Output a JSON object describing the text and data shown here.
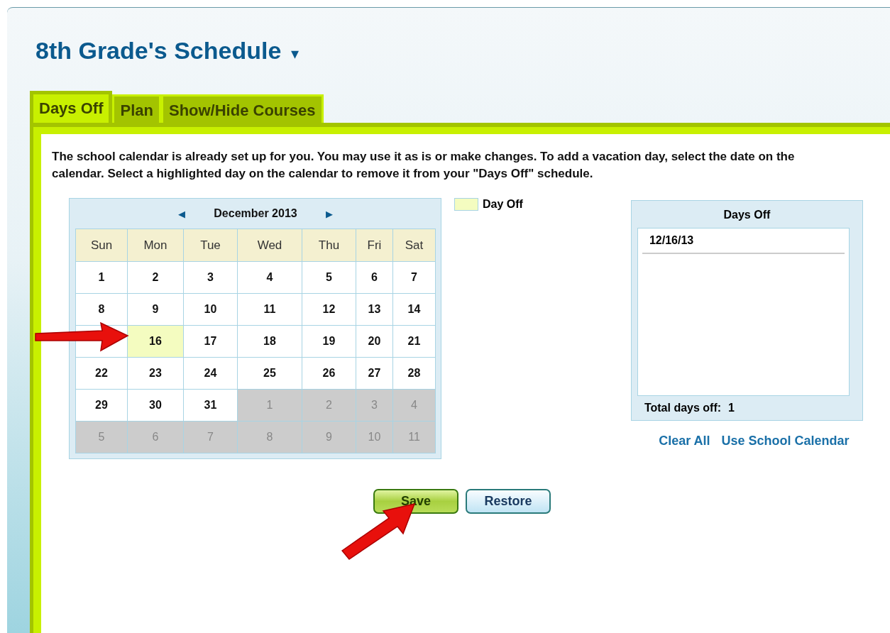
{
  "title": "8th Grade's Schedule",
  "title_menu_caret": "▾",
  "tabs": [
    {
      "label": "Days Off",
      "selected": true
    },
    {
      "label": "Plan",
      "selected": false
    },
    {
      "label": "Show/Hide Courses",
      "selected": false
    }
  ],
  "instructions": "The school calendar is already set up for you. You may use it as is or make changes. To add a vacation day, select the date on the calendar. Select a highlighted day on the calendar to remove it from your \"Days Off\" schedule.",
  "calendar": {
    "prev": "◀",
    "month": "December 2013",
    "next": "▶",
    "weekdays": [
      "Sun",
      "Mon",
      "Tue",
      "Wed",
      "Thu",
      "Fri",
      "Sat"
    ],
    "weeks": [
      [
        {
          "day": "1",
          "kind": "current",
          "selected": false
        },
        {
          "day": "2",
          "kind": "current",
          "selected": false
        },
        {
          "day": "3",
          "kind": "current",
          "selected": false
        },
        {
          "day": "4",
          "kind": "current",
          "selected": false
        },
        {
          "day": "5",
          "kind": "current",
          "selected": false
        },
        {
          "day": "6",
          "kind": "current",
          "selected": false
        },
        {
          "day": "7",
          "kind": "current",
          "selected": false
        }
      ],
      [
        {
          "day": "8",
          "kind": "current",
          "selected": false
        },
        {
          "day": "9",
          "kind": "current",
          "selected": false
        },
        {
          "day": "10",
          "kind": "current",
          "selected": false
        },
        {
          "day": "11",
          "kind": "current",
          "selected": false
        },
        {
          "day": "12",
          "kind": "current",
          "selected": false
        },
        {
          "day": "13",
          "kind": "current",
          "selected": false
        },
        {
          "day": "14",
          "kind": "current",
          "selected": false
        }
      ],
      [
        {
          "kind": "covered",
          "selected": false
        },
        {
          "day": "16",
          "kind": "current",
          "selected": true
        },
        {
          "day": "17",
          "kind": "current",
          "selected": false
        },
        {
          "day": "18",
          "kind": "current",
          "selected": false
        },
        {
          "day": "19",
          "kind": "current",
          "selected": false
        },
        {
          "day": "20",
          "kind": "current",
          "selected": false
        },
        {
          "day": "21",
          "kind": "current",
          "selected": false
        }
      ],
      [
        {
          "day": "22",
          "kind": "current",
          "selected": false
        },
        {
          "day": "23",
          "kind": "current",
          "selected": false
        },
        {
          "day": "24",
          "kind": "current",
          "selected": false
        },
        {
          "day": "25",
          "kind": "current",
          "selected": false
        },
        {
          "day": "26",
          "kind": "current",
          "selected": false
        },
        {
          "day": "27",
          "kind": "current",
          "selected": false
        },
        {
          "day": "28",
          "kind": "current",
          "selected": false
        }
      ],
      [
        {
          "day": "29",
          "kind": "current",
          "selected": false
        },
        {
          "day": "30",
          "kind": "current",
          "selected": false
        },
        {
          "day": "31",
          "kind": "current",
          "selected": false
        },
        {
          "day": "1",
          "kind": "other",
          "selected": false
        },
        {
          "day": "2",
          "kind": "other",
          "selected": false
        },
        {
          "day": "3",
          "kind": "other",
          "selected": false
        },
        {
          "day": "4",
          "kind": "other",
          "selected": false
        }
      ],
      [
        {
          "day": "5",
          "kind": "other",
          "selected": false
        },
        {
          "day": "6",
          "kind": "other",
          "selected": false
        },
        {
          "day": "7",
          "kind": "other",
          "selected": false
        },
        {
          "day": "8",
          "kind": "other",
          "selected": false
        },
        {
          "day": "9",
          "kind": "other",
          "selected": false
        },
        {
          "day": "10",
          "kind": "other",
          "selected": false
        },
        {
          "day": "11",
          "kind": "other",
          "selected": false
        }
      ]
    ]
  },
  "legend": {
    "label": "Day Off"
  },
  "days_off_panel": {
    "title": "Days Off",
    "dates": [
      "12/16/13"
    ],
    "total_label": "Total days off:",
    "total": "1"
  },
  "links": [
    "Clear All",
    "Use School Calendar"
  ],
  "buttons": [
    {
      "label": "Save",
      "kind": "primary"
    },
    {
      "label": "Restore",
      "kind": "secondary"
    }
  ]
}
